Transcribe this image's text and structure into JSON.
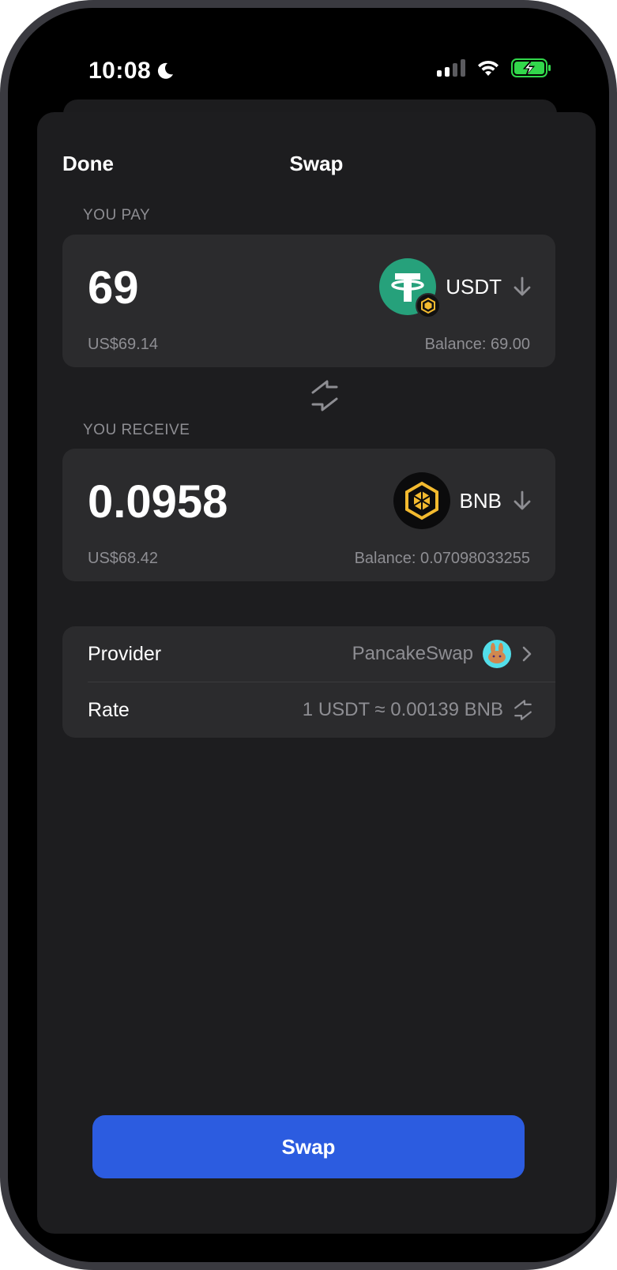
{
  "status": {
    "time": "10:08"
  },
  "nav": {
    "done_label": "Done",
    "title": "Swap"
  },
  "pay": {
    "label": "YOU PAY",
    "amount": "69",
    "usd_value": "US$69.14",
    "balance": "Balance: 69.00",
    "token": "USDT",
    "token_color": "#26A17B"
  },
  "receive": {
    "label": "YOU RECEIVE",
    "amount": "0.0958",
    "usd_value": "US$68.42",
    "balance": "Balance: 0.07098033255",
    "token": "BNB",
    "token_color": "#F3BA2F"
  },
  "info": {
    "provider_label": "Provider",
    "provider_value": "PancakeSwap",
    "rate_label": "Rate",
    "rate_value": "1 USDT ≈ 0.00139 BNB"
  },
  "action": {
    "swap_label": "Swap",
    "accent": "#2C5CE0"
  },
  "icons": [
    "moon-icon",
    "signal-icon",
    "wifi-icon",
    "battery-charging-icon",
    "usdt-icon",
    "bnb-chain-badge-icon",
    "chevron-down-icon",
    "swap-direction-icon",
    "bnb-icon",
    "pancakeswap-icon",
    "chevron-right-icon",
    "rate-swap-icon"
  ]
}
